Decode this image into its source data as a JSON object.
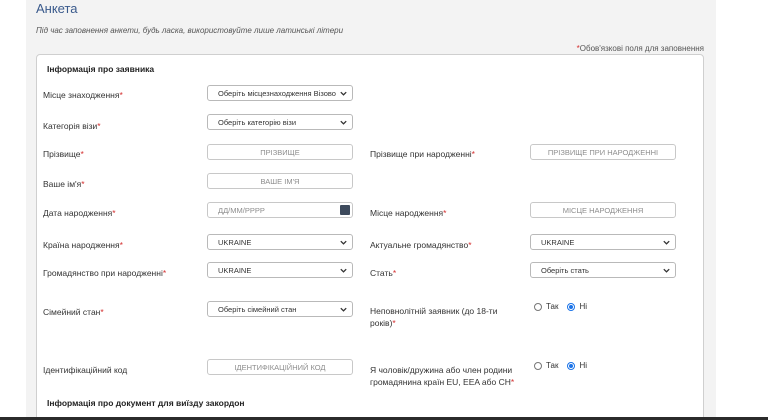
{
  "page": {
    "title": "Анкета",
    "instruction": "Під час заповнення анкети, будь ласка, використовуйте лише латинські літери",
    "required_star": "*",
    "required_note": "Обов'язкові поля для заповнення"
  },
  "applicant_section": {
    "title": "Інформація про заявника",
    "fields": {
      "location": {
        "label": "Місце знаходження",
        "value": "Оберіть місцезнаходження Візово"
      },
      "visa_category": {
        "label": "Категорія візи",
        "value": "Оберіть категорію візи"
      },
      "surname": {
        "label": "Прізвище",
        "placeholder": "ПРІЗВИЩЕ"
      },
      "birth_surname": {
        "label": "Прізвище при народженні",
        "placeholder": "ПРІЗВИЩЕ ПРИ НАРОДЖЕННІ"
      },
      "first_name": {
        "label": "Ваше ім'я",
        "placeholder": "ВАШЕ ІМ'Я"
      },
      "birth_date": {
        "label": "Дата народження",
        "placeholder": "ДД/ММ/РРРР"
      },
      "birth_place": {
        "label": "Місце народження",
        "placeholder": "МІСЦЕ НАРОДЖЕННЯ"
      },
      "birth_country": {
        "label": "Країна народження",
        "value": "UKRAINE"
      },
      "current_citizenship": {
        "label": "Актуальне громадянство",
        "value": "UKRAINE"
      },
      "birth_citizenship": {
        "label": "Громадянство при народженні",
        "value": "UKRAINE"
      },
      "gender": {
        "label": "Стать",
        "value": "Оберіть стать"
      },
      "marital_status": {
        "label": "Сімейний стан",
        "value": "Оберіть сімейний стан"
      },
      "minor": {
        "label_line1": "Неповнолітній заявник (до 18-ти",
        "label_line2": "років)",
        "yes": "Так",
        "no": "Ні",
        "selected": "no"
      },
      "id_code": {
        "label": "Ідентифікаційний код",
        "placeholder": "ІДЕНТИФІКАЦІЙНИЙ КОД"
      },
      "eu_family": {
        "label_line1": "Я чоловік/дружина або член родини",
        "label_line2": "громадянина країн EU, EEA або CH",
        "yes": "Так",
        "no": "Ні",
        "selected": "no"
      }
    }
  },
  "document_section": {
    "title": "Інформація про документ для виїзду закордон"
  },
  "colors": {
    "accent": "#1a73e8",
    "required": "#d42f2f",
    "title": "#3a5a8c"
  }
}
